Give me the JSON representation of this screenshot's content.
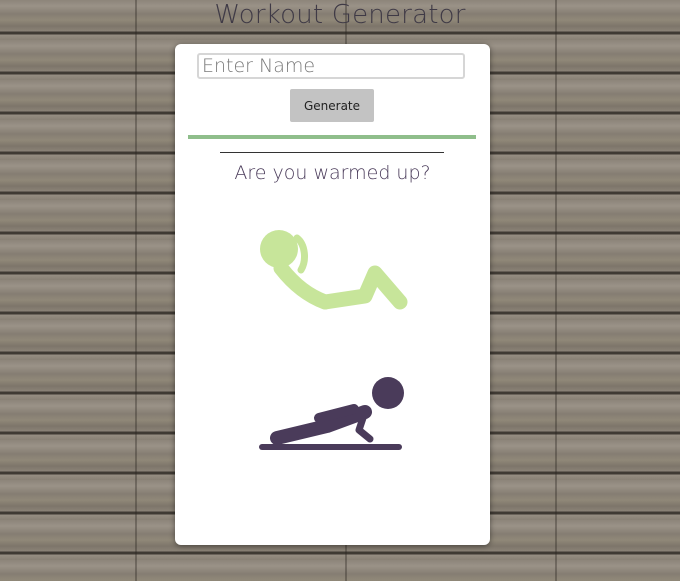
{
  "app": {
    "title": "Workout Generator"
  },
  "form": {
    "name_placeholder": "Enter Name",
    "name_value": "",
    "generate_label": "Generate"
  },
  "main": {
    "prompt": "Are you warmed up?"
  },
  "icons": {
    "situp": "situp-icon",
    "pushup": "pushup-icon"
  },
  "colors": {
    "accent_green": "#8fbe8b",
    "situp_figure": "#c7e59a",
    "pushup_figure": "#4a3b5a",
    "heading_text": "#3f3a46",
    "button_bg": "#c3c3c3"
  }
}
